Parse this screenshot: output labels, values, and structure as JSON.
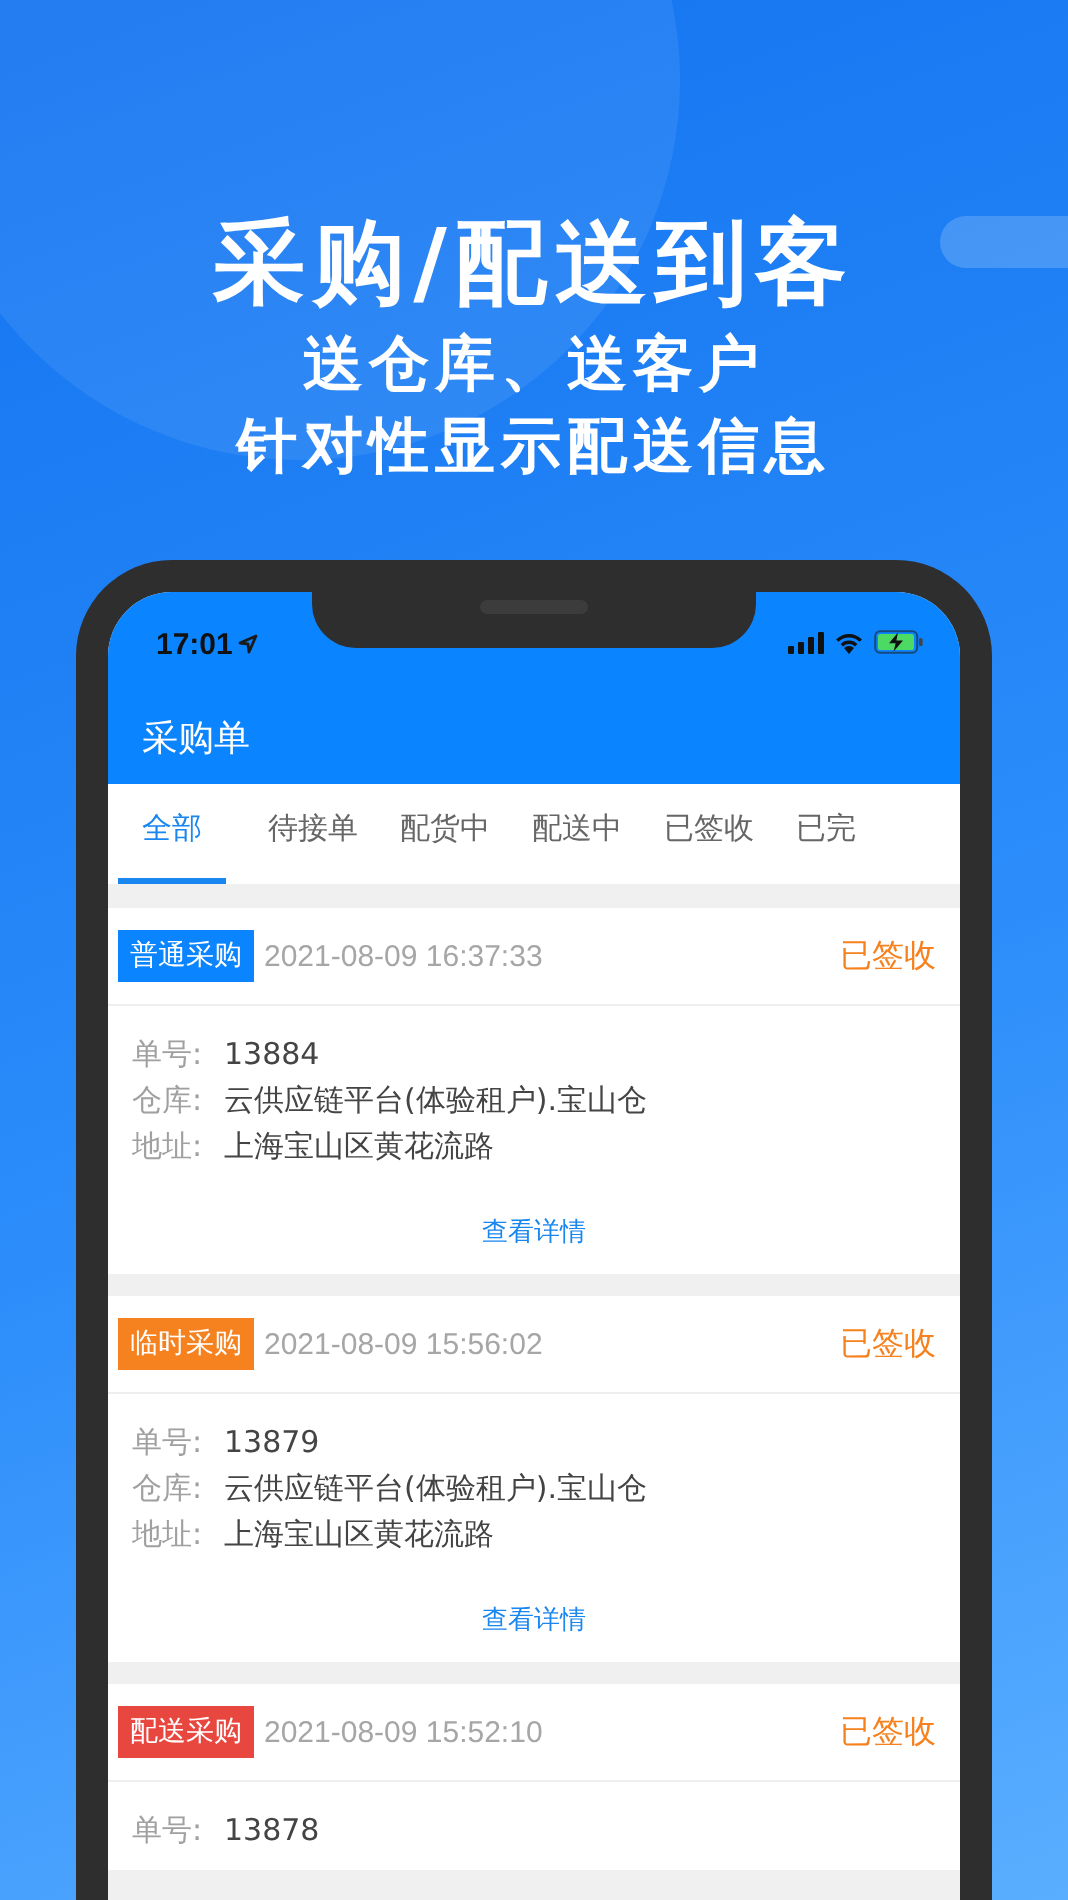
{
  "headline": "采购/配送到客",
  "subtitle_lines": [
    "送仓库、送客户",
    "针对性显示配送信息"
  ],
  "status_bar": {
    "time": "17:01"
  },
  "app_bar": {
    "title": "采购单"
  },
  "tabs": [
    {
      "label": "全部",
      "selected": true
    },
    {
      "label": "待接单",
      "selected": false
    },
    {
      "label": "配货中",
      "selected": false
    },
    {
      "label": "配送中",
      "selected": false
    },
    {
      "label": "已签收",
      "selected": false
    },
    {
      "label": "已完",
      "selected": false
    }
  ],
  "orders": [
    {
      "type_tag": "普通采购",
      "color": "#0a84ff",
      "datetime": "2021-08-09 16:37:33",
      "status": "已签收",
      "fields": [
        {
          "label": "单号:",
          "value": "13884"
        },
        {
          "label": "仓库:",
          "value": "云供应链平台(体验租户).宝山仓"
        },
        {
          "label": "地址:",
          "value": "上海宝山区黄花流路"
        }
      ],
      "link": "查看详情"
    },
    {
      "type_tag": "临时采购",
      "color": "#f5821f",
      "datetime": "2021-08-09 15:56:02",
      "status": "已签收",
      "fields": [
        {
          "label": "单号:",
          "value": "13879"
        },
        {
          "label": "仓库:",
          "value": "云供应链平台(体验租户).宝山仓"
        },
        {
          "label": "地址:",
          "value": "上海宝山区黄花流路"
        }
      ],
      "link": "查看详情"
    },
    {
      "type_tag": "配送采购",
      "color": "#e8473f",
      "datetime": "2021-08-09 15:52:10",
      "status": "已签收",
      "fields": [
        {
          "label": "单号:",
          "value": "13878"
        }
      ]
    }
  ]
}
